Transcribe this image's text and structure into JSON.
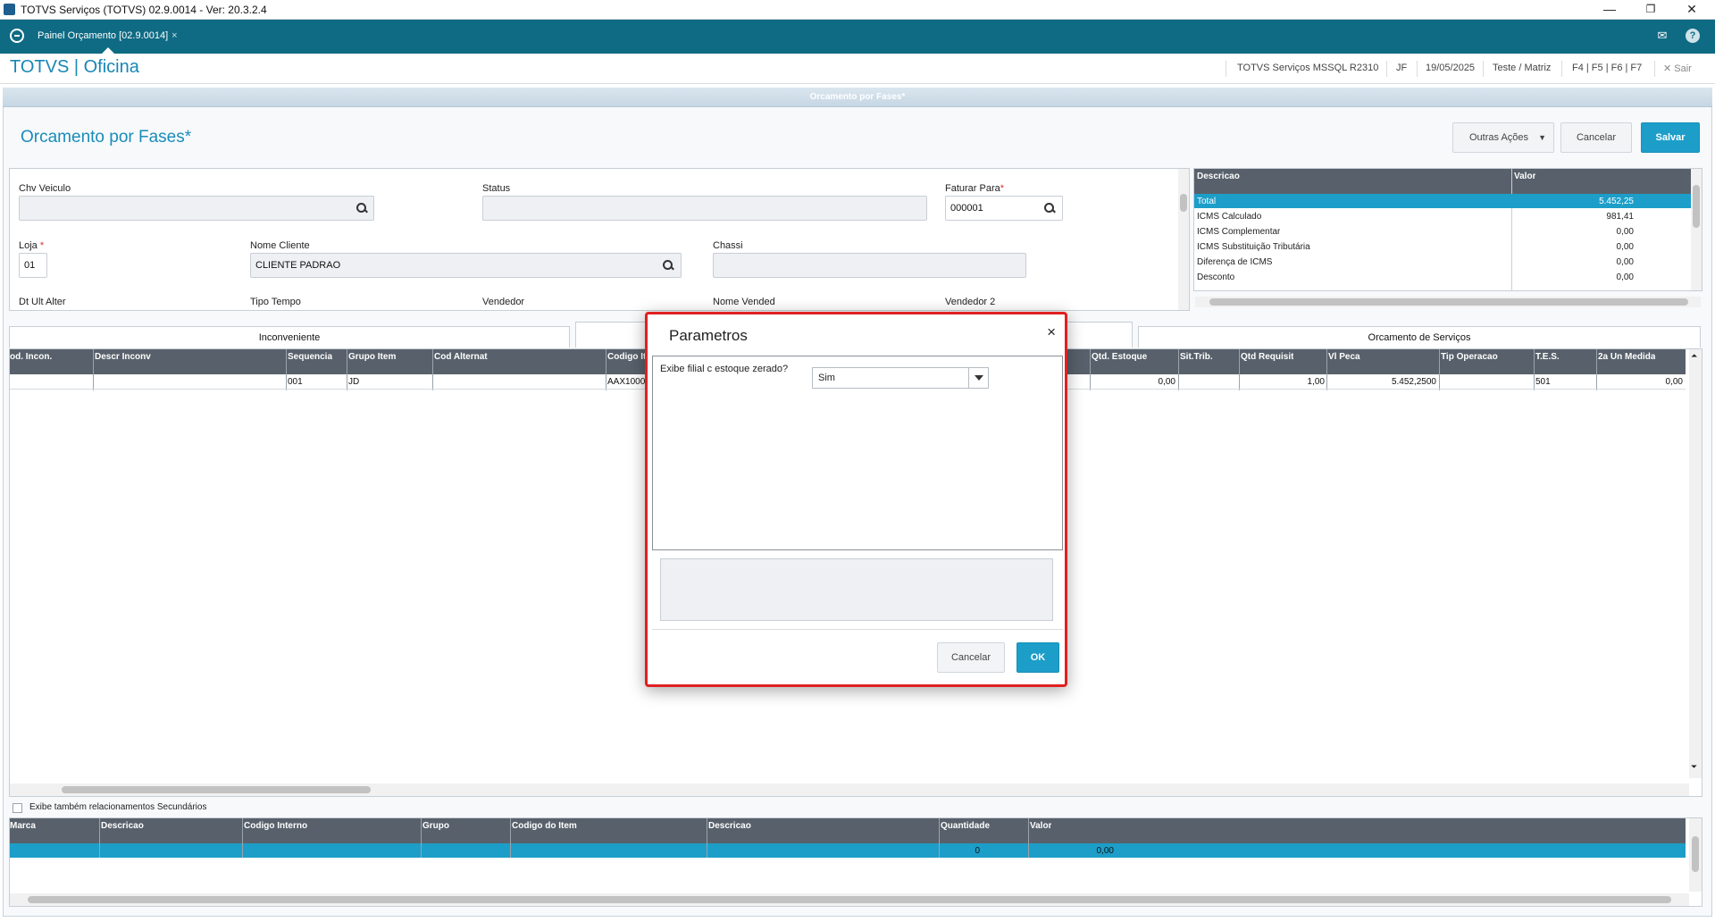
{
  "window": {
    "title": "TOTVS Serviços (TOTVS) 02.9.0014 - Ver: 20.3.2.4",
    "min": "—",
    "max": "❐",
    "close": "✕"
  },
  "tabstrip": {
    "tab_label": "Painel Orçamento [02.9.0014]",
    "tab_close": "×"
  },
  "header": {
    "brand": "TOTVS | Oficina",
    "environment": "TOTVS Serviços MSSQL R2310",
    "user": "JF",
    "date": "19/05/2025",
    "branch": "Teste / Matriz",
    "shortcuts": "F4 | F5 | F6 | F7",
    "exit": "Sair"
  },
  "page": {
    "banner": "Orcamento por Fases*",
    "title": "Orcamento por Fases*",
    "buttons": {
      "other_actions": "Outras Ações",
      "cancel": "Cancelar",
      "save": "Salvar"
    }
  },
  "form": {
    "chv_veiculo": {
      "label": "Chv Veiculo",
      "value": ""
    },
    "status": {
      "label": "Status",
      "value": ""
    },
    "faturar_para": {
      "label": "Faturar Para",
      "value": "000001"
    },
    "loja": {
      "label": "Loja",
      "value": "01"
    },
    "nome_cliente": {
      "label": "Nome Cliente",
      "value": "CLIENTE PADRAO"
    },
    "chassi": {
      "label": "Chassi",
      "value": ""
    },
    "dt_ult_alter": {
      "label": "Dt Ult Alter"
    },
    "tipo_tempo": {
      "label": "Tipo Tempo"
    },
    "vendedor": {
      "label": "Vendedor"
    },
    "nome_vended": {
      "label": "Nome Vended"
    },
    "vendedor2": {
      "label": "Vendedor 2"
    },
    "required_mark": "*"
  },
  "totals": {
    "headers": [
      "Descricao",
      "Valor"
    ],
    "rows": [
      {
        "desc": "Total",
        "value": "5.452,25",
        "selected": true
      },
      {
        "desc": "ICMS Calculado",
        "value": "981,41"
      },
      {
        "desc": "ICMS Complementar",
        "value": "0,00"
      },
      {
        "desc": "ICMS Substituição Tributária",
        "value": "0,00"
      },
      {
        "desc": "Diferença de ICMS",
        "value": "0,00"
      },
      {
        "desc": "Desconto",
        "value": "0,00"
      }
    ]
  },
  "folders": {
    "left": "Inconveniente",
    "right": "Orcamento de Serviços"
  },
  "items_grid": {
    "headers": {
      "cod_incon": "od. Incon.",
      "descr_inconv": "Descr Inconv",
      "sequencia": "Sequencia",
      "grupo_item": "Grupo Item",
      "cod_alternat": "Cod Alternat",
      "codigo_item": "Codigo It",
      "qtd_estoque": "Qtd. Estoque",
      "sit_trib": "Sit.Trib.",
      "qtd_requisit": "Qtd Requisit",
      "vl_peca": "Vl Peca",
      "tip_operacao": "Tip Operacao",
      "tes": "T.E.S.",
      "un_medida": "2a Un Medida"
    },
    "row": {
      "sequencia": "001",
      "grupo_item": "JD",
      "codigo_item": "AAX1000",
      "qtd_estoque": "0,00",
      "qtd_requisit": "1,00",
      "vl_peca": "5.452,2500",
      "tes": "501",
      "un_medida": "0,00"
    }
  },
  "secondary": {
    "checkbox_label": "Exibe também relacionamentos Secundários"
  },
  "footer_grid": {
    "headers": [
      "Marca",
      "Descricao",
      "Codigo Interno",
      "Grupo",
      "Codigo do Item",
      "Descricao",
      "Quantidade",
      "Valor"
    ],
    "row": {
      "quantidade": "0",
      "valor": "0,00"
    }
  },
  "dialog": {
    "title": "Parametros",
    "close": "×",
    "question": "Exibe filial c estoque zerado?",
    "selected": "Sim",
    "cancel": "Cancelar",
    "ok": "OK"
  },
  "colors": {
    "teal": "#0f6b84",
    "accent": "#1c9ec9",
    "grid_header": "#58616b",
    "highlight": "#1c9ec9",
    "dialog_border": "#e02020"
  }
}
